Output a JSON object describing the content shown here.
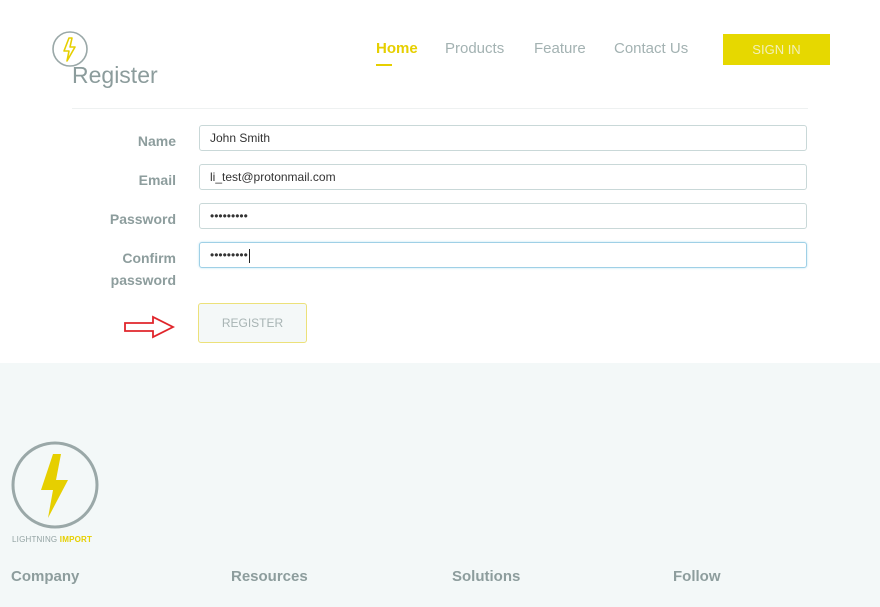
{
  "header": {
    "page_title": "Register",
    "nav": [
      "Home",
      "Products",
      "Feature",
      "Contact Us"
    ],
    "sign_in_label": "SIGN IN"
  },
  "form": {
    "name_label": "Name",
    "name_value": "John Smith",
    "email_label": "Email",
    "email_value": "li_test@protonmail.com",
    "password_label": "Password",
    "password_value": "•••••••••",
    "confirm_label_line1": "Confirm",
    "confirm_label_line2": "password",
    "confirm_value": "•••••••••",
    "register_label": "REGISTER"
  },
  "footer": {
    "brand_main": "LIGHTNING ",
    "brand_accent": "IMPORT",
    "headings": [
      "Company",
      "Resources",
      "Solutions",
      "Follow"
    ]
  },
  "colors": {
    "accent": "#e6cf00",
    "footer_bg": "#f3f8f8",
    "arrow": "#e0252b"
  },
  "icons": {
    "logo": "lightning-bolt-circle-icon",
    "arrow": "right-arrow-outline-icon"
  }
}
